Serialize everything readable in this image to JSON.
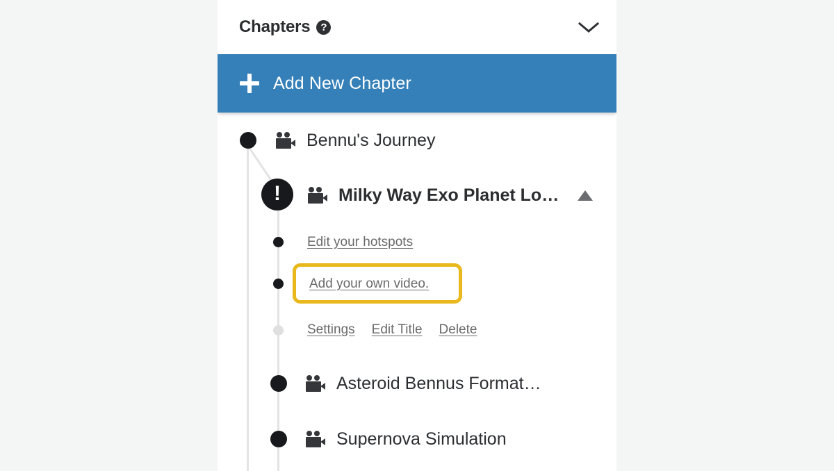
{
  "colors": {
    "panel_bg": "#ffffff",
    "page_bg": "#f4f5f5",
    "accent_blue": "#3580b8",
    "highlight_gold": "#e9b81c",
    "dark": "#17191c",
    "link_gray": "#6a6a6a",
    "rail_gray": "#e3e3e3"
  },
  "header": {
    "title": "Chapters",
    "help_badge": "?",
    "help_icon_name": "question-mark-icon",
    "collapse_icon_name": "chevron-down-icon"
  },
  "add_button": {
    "label": "Add New Chapter",
    "icon_name": "plus-icon"
  },
  "chapters": [
    {
      "title": "Bennu's Journey",
      "marker": "dot",
      "icon_name": "video-camera-icon",
      "selected": false
    },
    {
      "title": "Milky Way Exo Planet Lo…",
      "marker": "exclamation",
      "marker_glyph": "!",
      "icon_name": "video-camera-icon",
      "selected": true,
      "collapse_icon_name": "triangle-up-icon",
      "sub_links": [
        {
          "label": "Edit your hotspots",
          "highlighted": false
        },
        {
          "label": "Add your own video.",
          "highlighted": true
        }
      ],
      "actions": [
        {
          "label": "Settings"
        },
        {
          "label": "Edit Title"
        },
        {
          "label": "Delete"
        }
      ]
    },
    {
      "title": "Asteroid Bennus Format…",
      "marker": "dot",
      "icon_name": "video-camera-icon",
      "selected": false
    },
    {
      "title": "Supernova Simulation",
      "marker": "dot",
      "icon_name": "video-camera-icon",
      "selected": false
    }
  ]
}
